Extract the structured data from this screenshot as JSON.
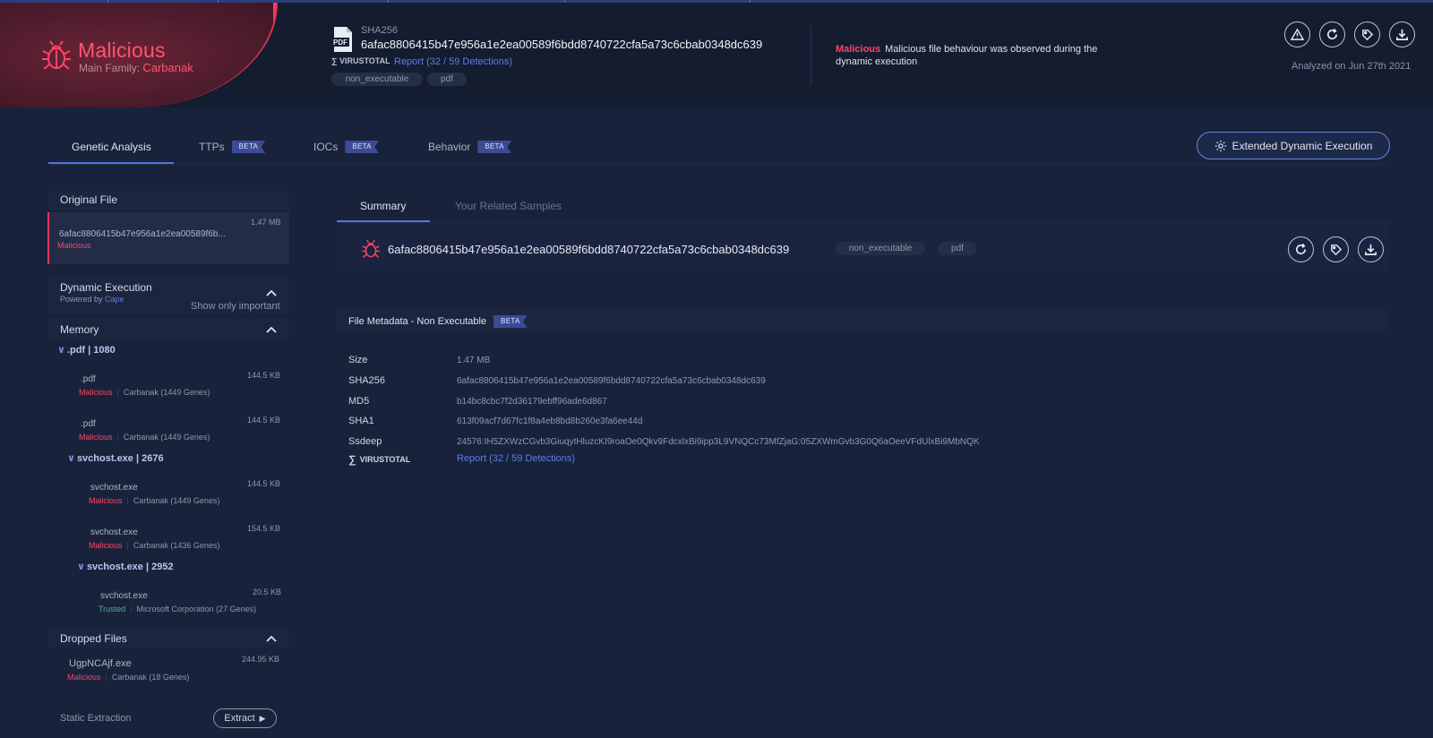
{
  "header": {
    "verdict": "Malicious",
    "family_label": "Main Family:",
    "family": "Carbanak",
    "sha_label": "SHA256",
    "sha256": "6afac8806415b47e956a1e2ea00589f6bdd8740722cfa5a73c6cbab0348dc639",
    "virustotal_label": "VIRUSTOTAL",
    "virustotal_link": "Report (32 / 59 Detections)",
    "tags": [
      "non_executable",
      "pdf"
    ],
    "message_verdict": "Malicious",
    "message": "Malicious file behaviour was observed during the dynamic execution",
    "analyzed": "Analyzed on Jun 27th 2021",
    "icons": [
      "warning-icon",
      "refresh-icon",
      "tag-icon",
      "download-icon"
    ]
  },
  "tabs": [
    {
      "label": "Genetic Analysis",
      "beta": ""
    },
    {
      "label": "TTPs",
      "beta": "BETA"
    },
    {
      "label": "IOCs",
      "beta": "BETA"
    },
    {
      "label": "Behavior",
      "beta": "BETA"
    }
  ],
  "extended_button": "Extended Dynamic Execution",
  "sidebar": {
    "original_file_title": "Original File",
    "original_file": {
      "name": "6afac8806415b47e956a1e2ea00589f6b...",
      "size": "1.47 MB",
      "verdict": "Malicious"
    },
    "dynamic_title": "Dynamic Execution",
    "dynamic_powered": "Powered by",
    "dynamic_powered_by": "Cape",
    "show_important": "Show only important",
    "memory_title": "Memory",
    "memory_nodes": [
      {
        "label": ".pdf | 1080"
      },
      {
        "label": "svchost.exe | 2676"
      },
      {
        "label": "svchost.exe | 2952"
      }
    ],
    "memory_files": [
      {
        "name": ".pdf",
        "size": "144.5 KB",
        "verdict": "Malicious",
        "family": "Carbanak (1449 Genes)"
      },
      {
        "name": ".pdf",
        "size": "144.5 KB",
        "verdict": "Malicious",
        "family": "Carbanak (1449 Genes)"
      },
      {
        "name": "svchost.exe",
        "size": "144.5 KB",
        "verdict": "Malicious",
        "family": "Carbanak (1449 Genes)"
      },
      {
        "name": "svchost.exe",
        "size": "154.5 KB",
        "verdict": "Malicious",
        "family": "Carbanak (1436 Genes)"
      },
      {
        "name": "svchost.exe",
        "size": "20.5 KB",
        "verdict": "Trusted",
        "family": "Microsoft Corporation (27 Genes)"
      }
    ],
    "dropped_title": "Dropped Files",
    "dropped_file": {
      "name": "UgpNCAjf.exe",
      "size": "244.95 KB",
      "verdict": "Malicious",
      "family": "Carbanak (18 Genes)"
    },
    "static_label": "Static Extraction",
    "extract_label": "Extract"
  },
  "subtabs": [
    "Summary",
    "Your Related Samples"
  ],
  "summary": {
    "hash": "6afac8806415b47e956a1e2ea00589f6bdd8740722cfa5a73c6cbab0348dc639",
    "tags": [
      "non_executable",
      "pdf"
    ]
  },
  "metadata": {
    "title": "File Metadata - Non Executable",
    "beta": "BETA",
    "rows": [
      {
        "key": "Size",
        "value": "1.47 MB"
      },
      {
        "key": "SHA256",
        "value": "6afac8806415b47e956a1e2ea00589f6bdd8740722cfa5a73c6cbab0348dc639"
      },
      {
        "key": "MD5",
        "value": "b14bc8cbc7f2d36179ebff96ade6d867"
      },
      {
        "key": "SHA1",
        "value": "613f09acf7d67fc1f8a4eb8bd8b260e3fa6ee44d"
      },
      {
        "key": "Ssdeep",
        "value": "24576:IH5ZXWzCGvb3GiuqytHluzcKI9roaOe0Qkv9FdcxlxBi9ipp3L9VNQCc73MfZjaG:05ZXWmGvb3G0Q6aOeeVFdUlxBi9MbNQK"
      }
    ],
    "vt_label": "VIRUSTOTAL",
    "vt_link": "Report (32 / 59 Detections)"
  },
  "colors": {
    "malicious": "#ff4466",
    "accent": "#5670e0",
    "trusted": "#49b0a2"
  }
}
